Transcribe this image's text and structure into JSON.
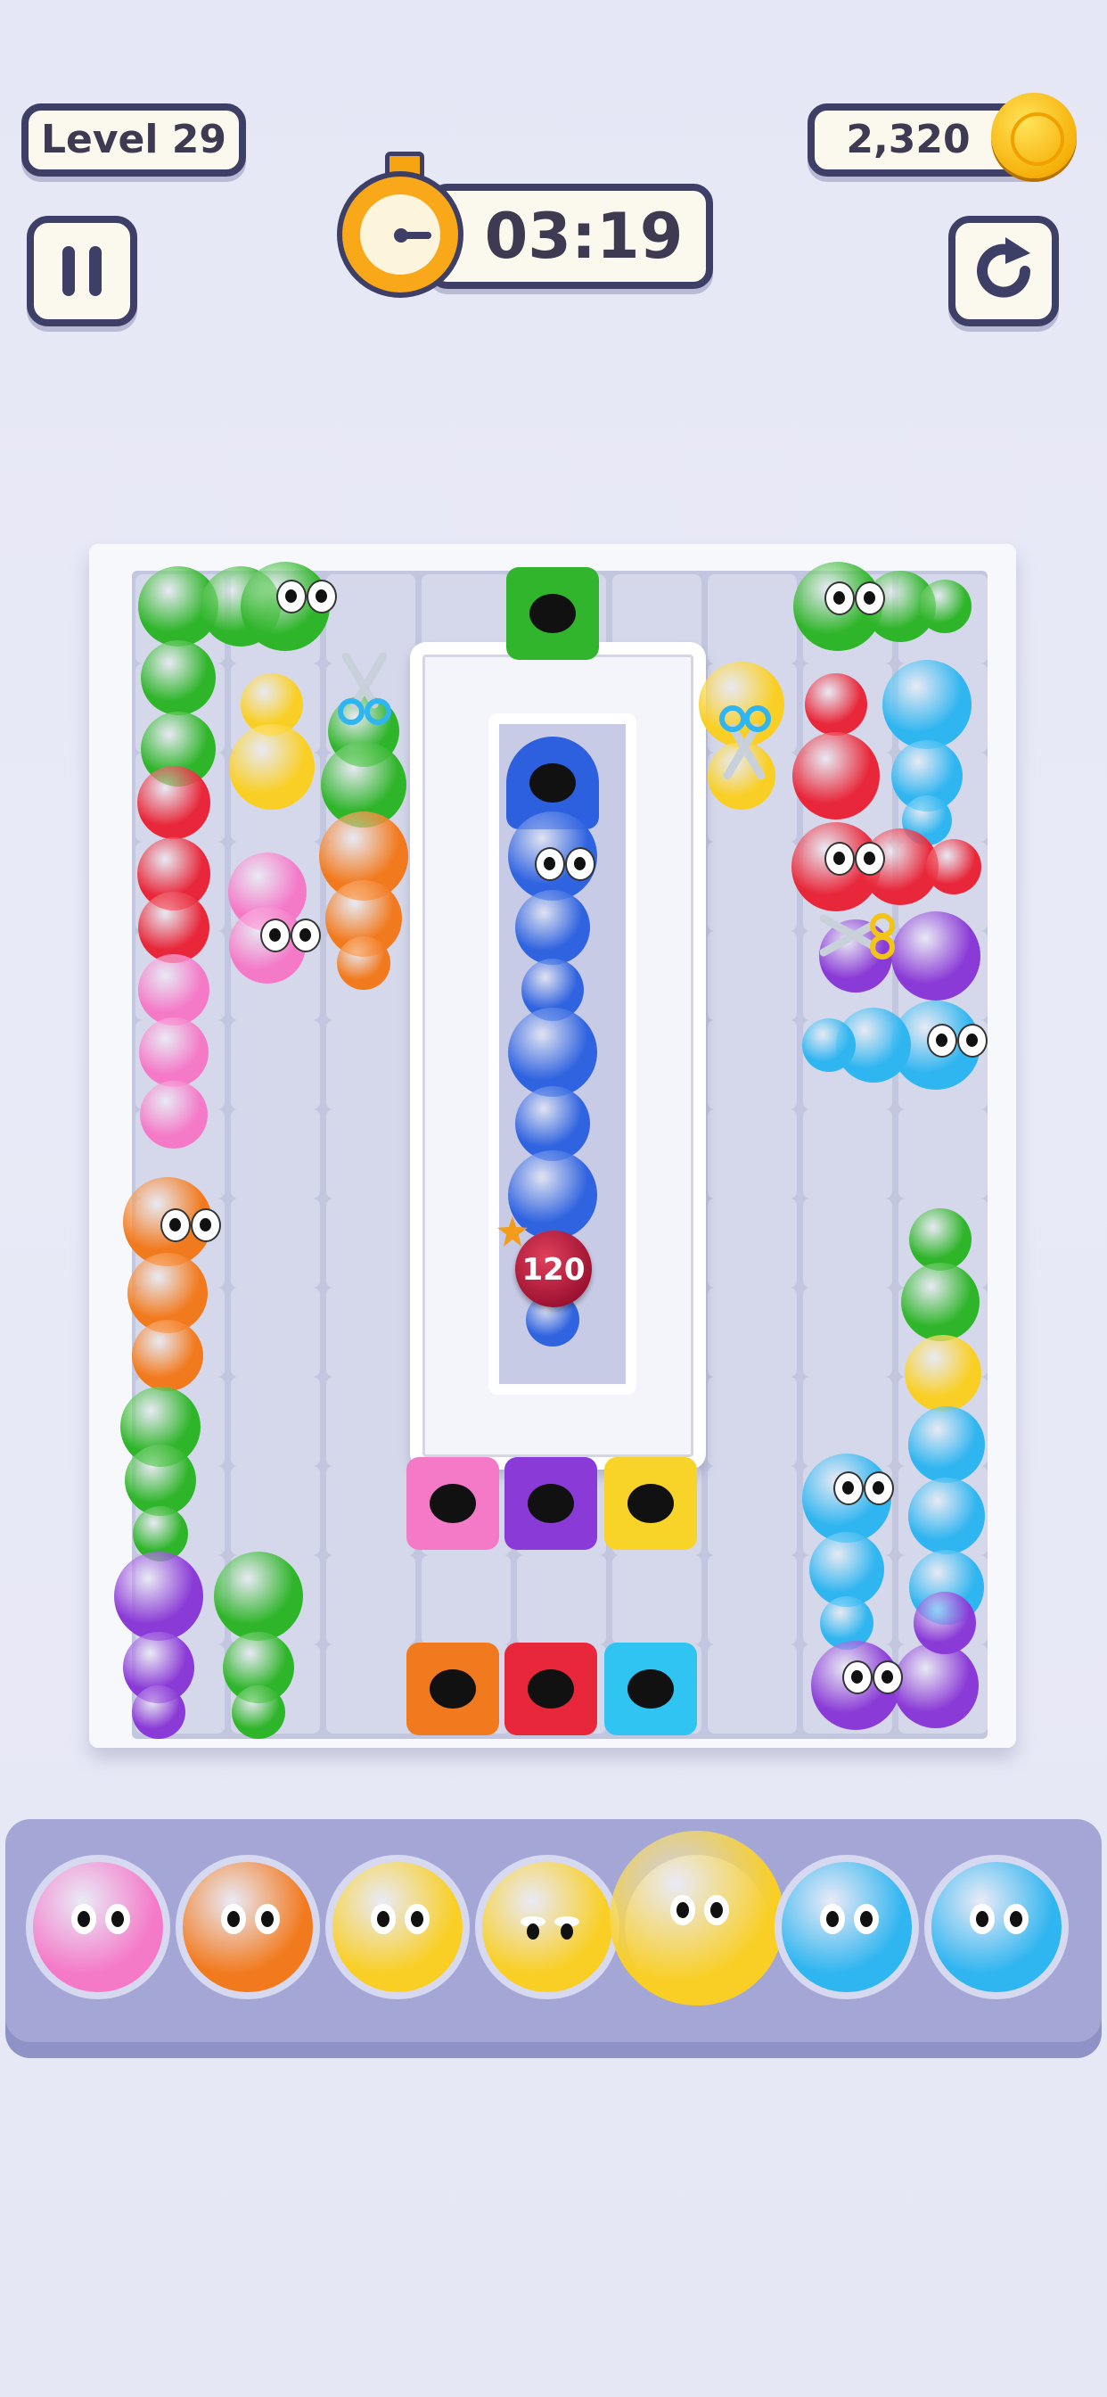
{
  "hud": {
    "level_label": "Level 29",
    "coins": "2,320",
    "timer": "03:19"
  },
  "board": {
    "bomb_value": "120"
  },
  "icons": [
    "pause-icon",
    "restart-icon",
    "stopwatch-icon",
    "coin-icon",
    "scissors-icon",
    "bomb-icon"
  ],
  "colors": {
    "green": "#2fb52a",
    "red": "#e8283a",
    "pink": "#f47ac8",
    "orange": "#f27a1e",
    "yellow": "#f9cf25",
    "blue": "#2f63e0",
    "cyan": "#2fb5f0",
    "purple": "#8a3ad6"
  },
  "holes": [
    "green",
    "blue",
    "pink",
    "purple",
    "yellow",
    "orange",
    "red",
    "cyan"
  ],
  "tray": [
    "pink",
    "orange",
    "yellow",
    "yellow-sleepy",
    "yellow-large",
    "cyan",
    "cyan"
  ]
}
